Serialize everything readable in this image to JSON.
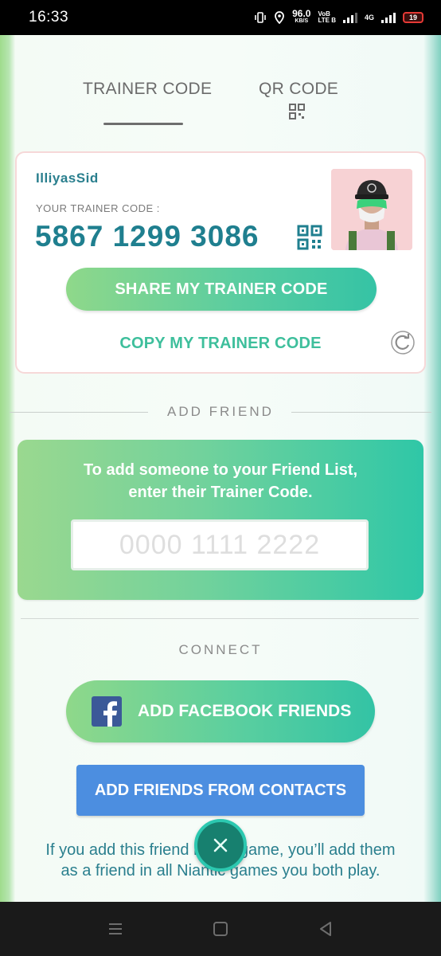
{
  "status_bar": {
    "time": "16:33",
    "net_speed_value": "96.0",
    "net_speed_unit": "KB/S",
    "volte_top": "VoB",
    "volte_bottom": "LTE B",
    "network_type": "4G",
    "battery_level": "19"
  },
  "tabs": [
    {
      "label": "TRAINER CODE",
      "active": true
    },
    {
      "label": "QR CODE",
      "active": false
    }
  ],
  "trainer_card": {
    "name": "IlliyasSid",
    "code_label": "YOUR TRAINER CODE :",
    "code_value": "5867 1299 3086",
    "share_button": "SHARE MY TRAINER CODE",
    "copy_link": "COPY MY TRAINER CODE"
  },
  "add_friend": {
    "section_title": "ADD FRIEND",
    "instructions": "To add someone to your Friend List, enter their Trainer Code.",
    "input_placeholder": "0000 1111 2222",
    "input_value": ""
  },
  "connect": {
    "section_title": "CONNECT",
    "facebook_button": "ADD FACEBOOK FRIENDS",
    "contacts_button": "ADD FRIENDS FROM CONTACTS",
    "footer_note": "If you add this friend in this game, you’ll add them as a friend in all Niantic games you both play."
  },
  "icons": {
    "qr": "qr-code-icon",
    "refresh": "refresh-icon",
    "facebook": "facebook-icon",
    "close": "close-icon",
    "nav": [
      "recents-icon",
      "home-icon",
      "back-icon"
    ]
  },
  "colors": {
    "accent_teal": "#1f7f8f",
    "accent_green": "#3ebf9c",
    "contacts_blue": "#4c8ee0",
    "facebook_blue": "#3b5998"
  }
}
